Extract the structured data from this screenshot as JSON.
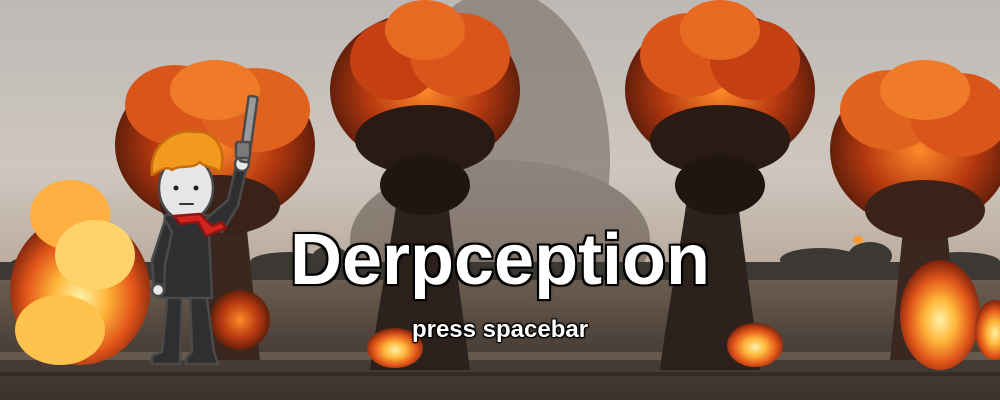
{
  "game": {
    "title": "Derpception",
    "prompt": "press spacebar"
  },
  "scene": {
    "background": "explosions-over-airfield",
    "character": "derp-character-with-pistol"
  },
  "colors": {
    "sky": "#c8c2bb",
    "fire_core": "#ffcf5a",
    "fire_mid": "#f07a1a",
    "fire_dark": "#8a2a0c",
    "smoke": "#2a1f1c",
    "ground": "#5a4e45",
    "title_text": "#ffffff",
    "outline": "#000000",
    "hair": "#f29a1e",
    "suit": "#2e2e30",
    "scarf": "#d2231f"
  }
}
